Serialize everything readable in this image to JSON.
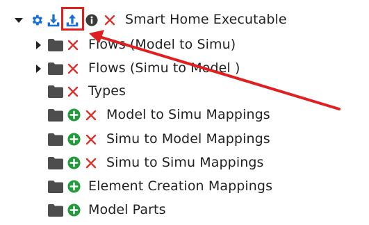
{
  "tree": {
    "root": {
      "label": "Smart Home Executable",
      "toolbar_icons": [
        "gear-icon",
        "download-icon",
        "upload-icon",
        "info-icon",
        "close-icon"
      ]
    },
    "children": [
      {
        "label": "Flows (Model to Simu)",
        "expandable": true,
        "has_add": false
      },
      {
        "label": "Flows (Simu to Model )",
        "expandable": true,
        "has_add": false
      },
      {
        "label": "Types",
        "expandable": false,
        "has_add": false
      },
      {
        "label": "Model to Simu Mappings",
        "expandable": false,
        "has_add": true
      },
      {
        "label": "Simu to Model Mappings",
        "expandable": false,
        "has_add": true
      },
      {
        "label": "Simu to Simu Mappings",
        "expandable": false,
        "has_add": true
      },
      {
        "label": "Element Creation Mappings",
        "expandable": false,
        "has_add": true,
        "no_delete": true
      },
      {
        "label": "Model Parts",
        "expandable": false,
        "has_add": true,
        "no_delete": true
      }
    ]
  },
  "colors": {
    "accent_blue": "#1a6fd4",
    "delete_red": "#d9312b",
    "add_green": "#239a3b",
    "folder_gray": "#4d4d4d",
    "annotation_red": "#e02020"
  }
}
